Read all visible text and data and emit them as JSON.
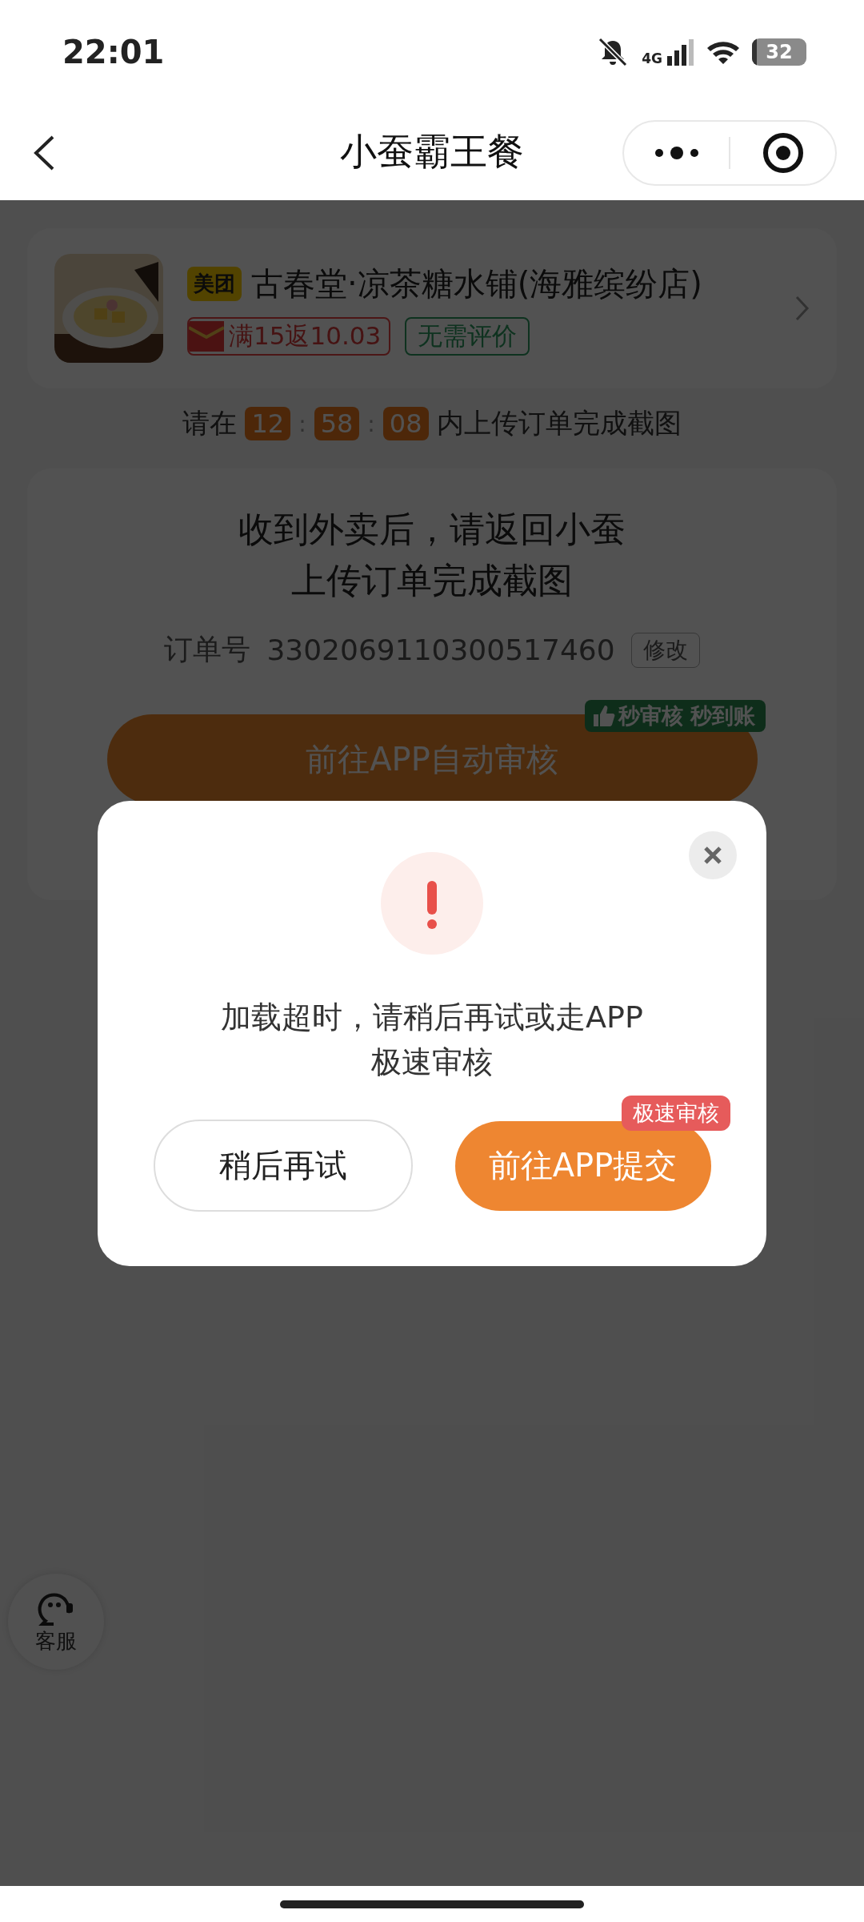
{
  "status_bar": {
    "time": "22:01",
    "network": "4G",
    "battery": "32"
  },
  "header": {
    "title": "小蚕霸王餐"
  },
  "shop": {
    "platform": "美团",
    "name": "古春堂·凉茶糖水铺(海雅缤纷店)",
    "tags": [
      {
        "kind": "rebate",
        "text": "满15返10.03"
      },
      {
        "kind": "plain",
        "text": "无需评价"
      }
    ]
  },
  "countdown": {
    "prefix": "请在",
    "parts": [
      {
        "kind": "digit",
        "text": "12"
      },
      {
        "kind": "colon",
        "text": ":"
      },
      {
        "kind": "digit",
        "text": "58"
      },
      {
        "kind": "colon",
        "text": ":"
      },
      {
        "kind": "digit",
        "text": "08"
      }
    ],
    "suffix": "内上传订单完成截图"
  },
  "order_card": {
    "title_lines": [
      "收到外卖后，请返回小蚕",
      "上传订单完成截图"
    ],
    "order_label": "订单号",
    "order_number": "3302069110300517460",
    "edit_button": "修改",
    "primary_button": "前往APP自动审核",
    "badge": "秒审核 秒到账"
  },
  "customer_service": {
    "label": "客服"
  },
  "dialog": {
    "message_lines": [
      "加载超时，请稍后再试或走APP",
      "极速审核"
    ],
    "buttons": [
      {
        "kind": "secondary",
        "label": "稍后再试"
      },
      {
        "kind": "primary",
        "label": "前往APP提交",
        "badge": "极速审核"
      }
    ]
  }
}
